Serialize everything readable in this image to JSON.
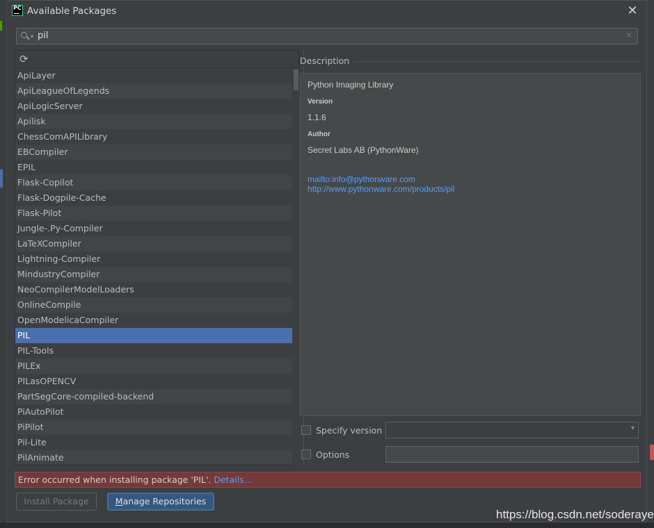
{
  "window": {
    "title": "Available Packages",
    "app_icon": "pycharm-icon",
    "app_icon_text": "PC",
    "close_icon": "close-icon"
  },
  "search": {
    "value": "pil",
    "icon": "search-icon",
    "clear_icon": "clear-icon"
  },
  "toolbar": {
    "refresh_icon": "refresh-icon"
  },
  "packages": {
    "selected": "PIL",
    "items": [
      "ApiLayer",
      "ApiLeagueOfLegends",
      "ApiLogicServer",
      "Apilisk",
      "ChessComAPILibrary",
      "EBCompiler",
      "EPIL",
      "Flask-Copilot",
      "Flask-Dogpile-Cache",
      "Flask-Pilot",
      "Jungle-.Py-Compiler",
      "LaTeXCompiler",
      "Lightning-Compiler",
      "MindustryCompiler",
      "NeoCompilerModelLoaders",
      "OnlineCompile",
      "OpenModelicaCompiler",
      "PIL",
      "PIL-Tools",
      "PILEx",
      "PILasOPENCV",
      "PartSegCore-compiled-backend",
      "PiAutoPilot",
      "PiPilot",
      "Pil-Lite",
      "PilAnimate"
    ]
  },
  "description": {
    "label": "Description",
    "package_name": "Python Imaging Library",
    "version_label": "Version",
    "version": "1.1.6",
    "author_label": "Author",
    "author": "Secret Labs AB (PythonWare)",
    "email_link": "mailto:info@pythonware.com",
    "home_link": "http://www.pythonware.com/products/pil"
  },
  "options": {
    "specify_version_label": "Specify version",
    "specify_version_checked": false,
    "version_select_value": "",
    "options_label": "Options",
    "options_checked": false,
    "options_value": ""
  },
  "error": {
    "message": "Error occurred when installing package 'PIL'.",
    "details_link": "Details..."
  },
  "buttons": {
    "install": "Install Package",
    "manage_mnemonic": "M",
    "manage_rest": "anage Repositories"
  },
  "watermark": "https://blog.csdn.net/soderayer",
  "colors": {
    "dialog_bg": "#3c3f41",
    "selection": "#4b6eaf",
    "link": "#589df6",
    "error_bg": "#743a3a",
    "primary_button": "#365880"
  }
}
